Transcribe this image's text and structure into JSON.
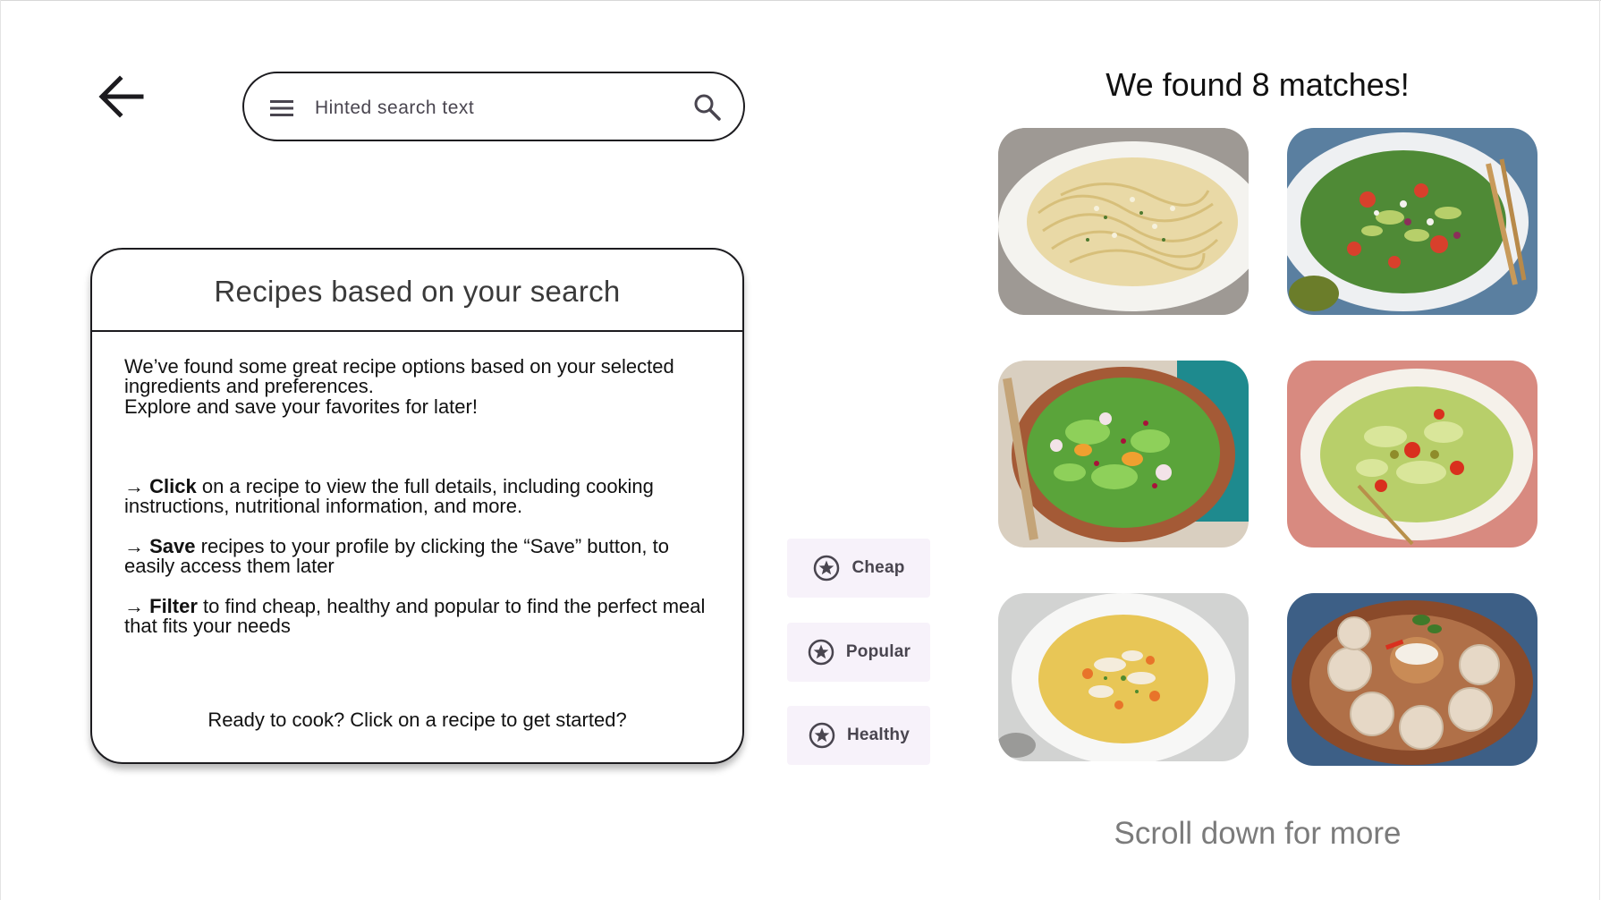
{
  "header": {
    "back_icon": "arrow-left-icon",
    "search": {
      "placeholder": "Hinted search text",
      "menu_icon": "hamburger-menu-icon",
      "search_icon": "magnifier-search-icon"
    }
  },
  "info_card": {
    "title": "Recipes based on your search",
    "intro": "We’ve found some great recipe options based on your selected ingredients and preferences.",
    "explore": "Explore and save your favorites for later!",
    "tips": [
      {
        "arrow": "→",
        "keyword": "Click",
        "text": " on a recipe to view the full details, including cooking instructions, nutritional information, and more."
      },
      {
        "arrow": "→",
        "keyword": "Save",
        "text": " recipes to your profile by clicking the “Save” button, to easily access them later"
      },
      {
        "arrow": "→",
        "keyword": "Filter",
        "text": " to find cheap, healthy and popular to find the perfect meal that fits your needs"
      }
    ],
    "footer": "Ready to cook? Click on a recipe to get started?"
  },
  "filters": [
    {
      "label": "Cheap",
      "icon": "star-circle-icon"
    },
    {
      "label": "Popular",
      "icon": "star-circle-icon"
    },
    {
      "label": "Healthy",
      "icon": "star-circle-icon"
    }
  ],
  "results": {
    "heading": "We found 8 matches!",
    "scroll_hint": "Scroll down for more",
    "recipes": [
      {
        "image": "spaghetti-plate-photo"
      },
      {
        "image": "avocado-tomato-salad-photo"
      },
      {
        "image": "green-salad-wooden-bowl-photo"
      },
      {
        "image": "lettuce-salad-white-bowl-photo"
      },
      {
        "image": "chicken-vegetable-soup-photo"
      },
      {
        "image": "dumplings-plate-photo"
      }
    ]
  },
  "colors": {
    "outline": "#1c1b1f",
    "chip_bg": "#f7f2fa",
    "chip_text": "#49454f",
    "muted_text": "#7b7b7b"
  }
}
